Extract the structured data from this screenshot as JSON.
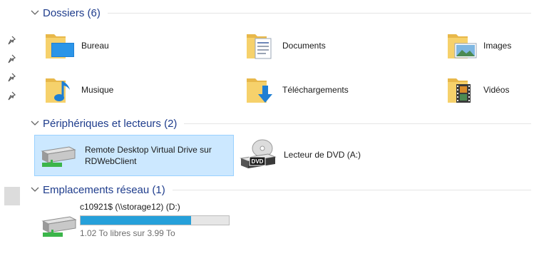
{
  "groups": {
    "folders": {
      "title": "Dossiers (6)"
    },
    "devices": {
      "title": "Périphériques et lecteurs (2)"
    },
    "network": {
      "title": "Emplacements réseau (1)"
    }
  },
  "folders": [
    {
      "label": "Bureau",
      "icon": "desktop-folder-icon"
    },
    {
      "label": "Documents",
      "icon": "documents-folder-icon"
    },
    {
      "label": "Images",
      "icon": "pictures-folder-icon"
    },
    {
      "label": "Musique",
      "icon": "music-folder-icon"
    },
    {
      "label": "Téléchargements",
      "icon": "downloads-folder-icon"
    },
    {
      "label": "Vidéos",
      "icon": "videos-folder-icon"
    }
  ],
  "devices": [
    {
      "label_line1": "Remote Desktop Virtual Drive sur",
      "label_line2": "RDWebClient",
      "icon": "network-drive-icon",
      "selected": true
    },
    {
      "label_line1": "Lecteur de DVD (A:)",
      "icon": "dvd-drive-icon",
      "dvd_text": "DVD",
      "selected": false
    }
  ],
  "network": {
    "name": "c10921$ (\\\\storage12) (D:)",
    "free_text": "1.02 To libres sur 3.99 To",
    "used_fraction": 0.744,
    "icon": "network-drive-icon"
  },
  "colors": {
    "header_text": "#1e3c8c",
    "selection_bg": "#cce8ff",
    "selection_border": "#99d1ff",
    "bar_fill": "#26a0da",
    "folder_yellow": "#f6d16b"
  }
}
